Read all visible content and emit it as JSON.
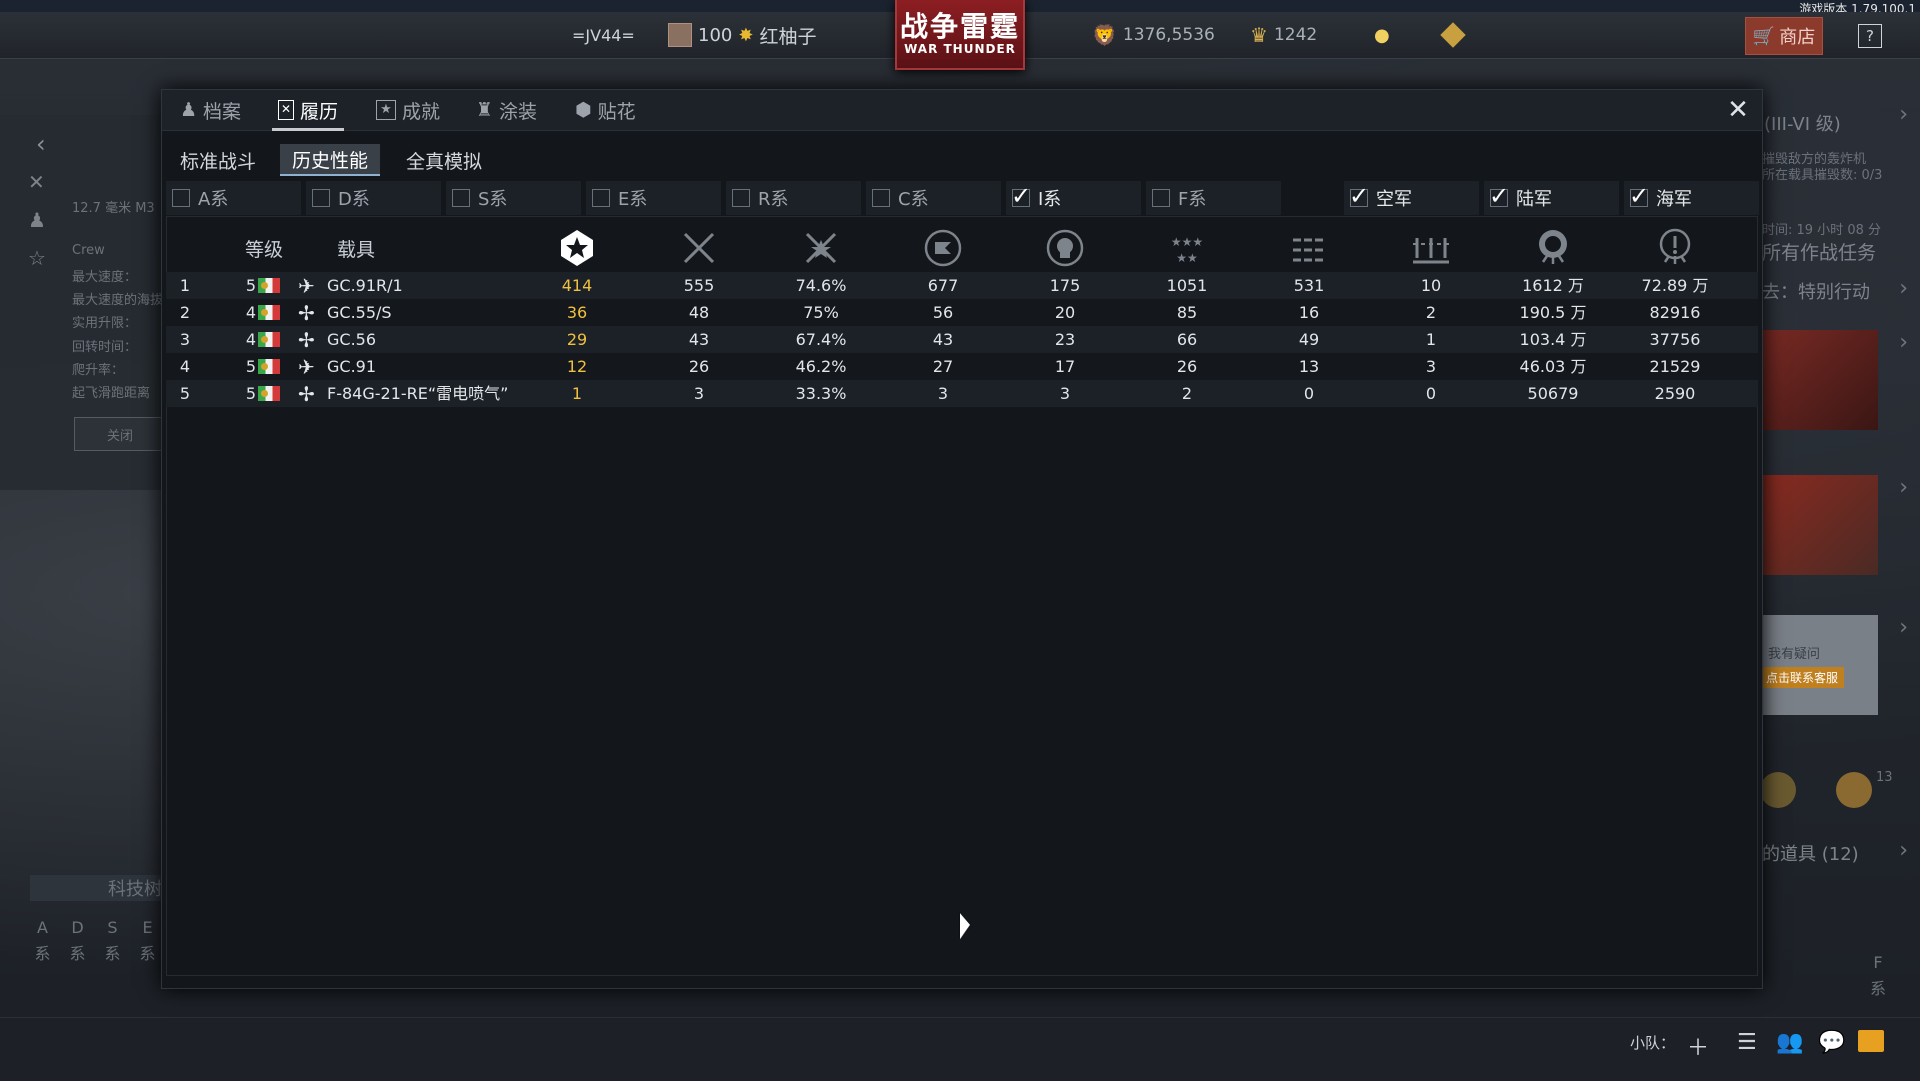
{
  "version": "游戏版本 1.79.100.1",
  "topbar": {
    "squadron_tag": "=JV44=",
    "level": "100",
    "player_name": "红柚子",
    "logo_cn": "战争雷霆",
    "logo_en": "WAR THUNDER",
    "silver_lions": "1376,5536",
    "golden_eagles": "1242",
    "shop_label": "商店",
    "help_label": "?"
  },
  "left_panel": {
    "weapon": "12.7 毫米 M3",
    "crew": "Crew",
    "rows": [
      "最大速度：",
      "最大速度的海拔",
      "实用升限：",
      "回转时间：",
      "爬升率：",
      "起飞滑跑距离"
    ],
    "close": "关闭",
    "tech_tree": "科技树",
    "tech_cols": [
      [
        "A",
        "系"
      ],
      [
        "D",
        "系"
      ],
      [
        "S",
        "系"
      ],
      [
        "E",
        "系"
      ]
    ]
  },
  "right_panel": {
    "tier": "(III-VI 级)",
    "task1": "摧毁敌方的轰炸机",
    "task2": "所在载具摧毁数: 0/3",
    "time": "时间: 19 小时 08 分",
    "all_tasks": "所有作战任务",
    "special_op": "去：特别行动",
    "help_text1": "我有疑问",
    "help_text2": "点击联系客服",
    "items": "的道具 (12)",
    "badge_count": "13",
    "f_col": [
      "F",
      "系"
    ]
  },
  "bottombar": {
    "squad_label": "小队："
  },
  "dialog": {
    "tabs": [
      {
        "label": "档案",
        "icon": "person-icon"
      },
      {
        "label": "履历",
        "icon": "record-icon",
        "active": true
      },
      {
        "label": "成就",
        "icon": "star-icon"
      },
      {
        "label": "涂装",
        "icon": "paint-icon"
      },
      {
        "label": "贴花",
        "icon": "decal-icon"
      }
    ],
    "subtabs": [
      {
        "label": "标准战斗"
      },
      {
        "label": "历史性能",
        "active": true
      },
      {
        "label": "全真模拟"
      }
    ],
    "filters": [
      {
        "label": "A系",
        "checked": false
      },
      {
        "label": "D系",
        "checked": false
      },
      {
        "label": "S系",
        "checked": false
      },
      {
        "label": "E系",
        "checked": false
      },
      {
        "label": "R系",
        "checked": false
      },
      {
        "label": "C系",
        "checked": false
      },
      {
        "label": "I系",
        "checked": true
      },
      {
        "label": "F系",
        "checked": false
      },
      {
        "label": "空军",
        "checked": true
      },
      {
        "label": "陆军",
        "checked": true
      },
      {
        "label": "海军",
        "checked": true
      }
    ],
    "columns": {
      "rank": "等级",
      "vehicle": "载具",
      "icons": [
        "victories-icon",
        "air-kills-icon",
        "win-rate-icon",
        "missions-icon",
        "deaths-icon",
        "ground-kills-icon",
        "naval-kills-icon",
        "ship-kills-icon",
        "lions-icon",
        "research-icon"
      ]
    },
    "rows": [
      {
        "num": "1",
        "rank": "5",
        "vehicle": "GC.91R/1",
        "type": "jet",
        "c1": "414",
        "c2": "555",
        "c3": "74.6%",
        "c4": "677",
        "c5": "175",
        "c6": "1051",
        "c7": "531",
        "c8": "10",
        "c9": "1612 万",
        "c10": "72.89 万"
      },
      {
        "num": "2",
        "rank": "4",
        "vehicle": "GC.55/S",
        "type": "prop",
        "c1": "36",
        "c2": "48",
        "c3": "75%",
        "c4": "56",
        "c5": "20",
        "c6": "85",
        "c7": "16",
        "c8": "2",
        "c9": "190.5 万",
        "c10": "82916"
      },
      {
        "num": "3",
        "rank": "4",
        "vehicle": "GC.56",
        "type": "prop",
        "c1": "29",
        "c2": "43",
        "c3": "67.4%",
        "c4": "43",
        "c5": "23",
        "c6": "66",
        "c7": "49",
        "c8": "1",
        "c9": "103.4 万",
        "c10": "37756"
      },
      {
        "num": "4",
        "rank": "5",
        "vehicle": "GC.91",
        "type": "jet",
        "c1": "12",
        "c2": "26",
        "c3": "46.2%",
        "c4": "27",
        "c5": "17",
        "c6": "26",
        "c7": "13",
        "c8": "3",
        "c9": "46.03 万",
        "c10": "21529"
      },
      {
        "num": "5",
        "rank": "5",
        "vehicle": "F-84G-21-RE“雷电喷气”",
        "type": "prop",
        "c1": "1",
        "c2": "3",
        "c3": "33.3%",
        "c4": "3",
        "c5": "3",
        "c6": "2",
        "c7": "0",
        "c8": "0",
        "c9": "50679",
        "c10": "2590"
      }
    ]
  },
  "colors": {
    "gold_value": "#f0c040",
    "shop_bg": "#8c3a2c",
    "logo_bg": "#8c1e22"
  }
}
